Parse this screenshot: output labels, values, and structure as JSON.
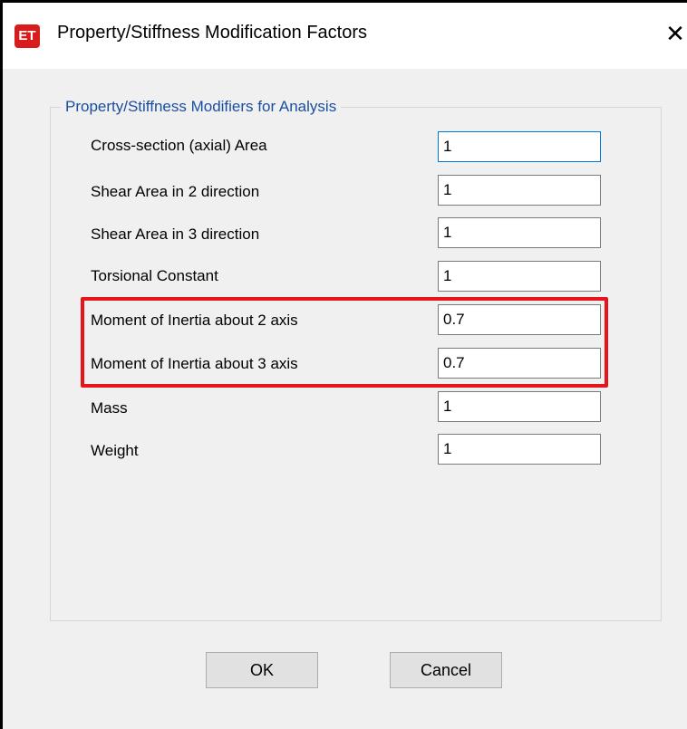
{
  "window": {
    "app_icon_text": "ET",
    "title": "Property/Stiffness Modification Factors",
    "close_glyph": "✕"
  },
  "group": {
    "title": "Property/Stiffness Modifiers for Analysis"
  },
  "rows": [
    {
      "label": "Cross-section (axial) Area",
      "value": "1"
    },
    {
      "label": "Shear Area in 2 direction",
      "value": "1"
    },
    {
      "label": "Shear Area in 3 direction",
      "value": "1"
    },
    {
      "label": "Torsional Constant",
      "value": "1"
    },
    {
      "label": "Moment of Inertia about 2 axis",
      "value": "0.7"
    },
    {
      "label": "Moment of Inertia about 3 axis",
      "value": "0.7"
    },
    {
      "label": "Mass",
      "value": "1"
    },
    {
      "label": "Weight",
      "value": "1"
    }
  ],
  "buttons": {
    "ok": "OK",
    "cancel": "Cancel"
  },
  "colors": {
    "highlight": "#e8141c",
    "group_title": "#1a4fa0",
    "app_icon": "#d81b1b",
    "focus_border": "#0078d7"
  }
}
